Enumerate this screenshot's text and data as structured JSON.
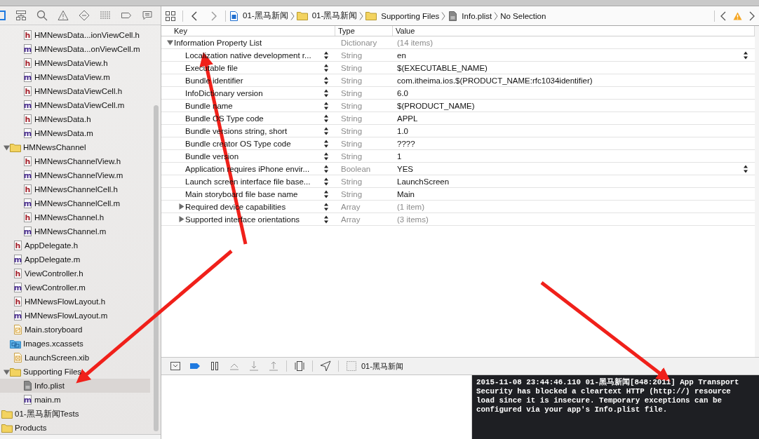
{
  "navigator": {
    "tree": [
      {
        "children": [
          {
            "children": [
              {
                "kind": "header",
                "icon_letter": "h",
                "label": "HMNewsData...ionViewCell.h",
                "selected": false
              },
              {
                "kind": "source",
                "icon_letter": "m",
                "label": "HMNewsData...onViewCell.m",
                "selected": false
              },
              {
                "kind": "header",
                "icon_letter": "h",
                "label": "HMNewsDataView.h",
                "selected": false
              },
              {
                "kind": "source",
                "icon_letter": "m",
                "label": "HMNewsDataView.m",
                "selected": false
              },
              {
                "kind": "header",
                "icon_letter": "h",
                "label": "HMNewsDataViewCell.h",
                "selected": false
              },
              {
                "kind": "source",
                "icon_letter": "m",
                "label": "HMNewsDataViewCell.m",
                "selected": false
              },
              {
                "kind": "header",
                "icon_letter": "h",
                "label": "HMNewsData.h",
                "selected": false
              },
              {
                "kind": "source",
                "icon_letter": "m",
                "label": "HMNewsData.m",
                "selected": false
              }
            ]
          },
          {
            "kind": "folder",
            "label": "HMNewsChannel",
            "expanded": true,
            "selected": false,
            "children": [
              {
                "kind": "header",
                "icon_letter": "h",
                "label": "HMNewsChannelView.h",
                "selected": false
              },
              {
                "kind": "source",
                "icon_letter": "m",
                "label": "HMNewsChannelView.m",
                "selected": false
              },
              {
                "kind": "header",
                "icon_letter": "h",
                "label": "HMNewsChannelCell.h",
                "selected": false
              },
              {
                "kind": "source",
                "icon_letter": "m",
                "label": "HMNewsChannelCell.m",
                "selected": false
              },
              {
                "kind": "header",
                "icon_letter": "h",
                "label": "HMNewsChannel.h",
                "selected": false
              },
              {
                "kind": "source",
                "icon_letter": "m",
                "label": "HMNewsChannel.m",
                "selected": false
              }
            ]
          },
          {
            "kind": "header",
            "icon_letter": "h",
            "label": "AppDelegate.h",
            "selected": false
          },
          {
            "kind": "source",
            "icon_letter": "m",
            "label": "AppDelegate.m",
            "selected": false
          },
          {
            "kind": "header",
            "icon_letter": "h",
            "label": "ViewController.h",
            "selected": false
          },
          {
            "kind": "source",
            "icon_letter": "m",
            "label": "ViewController.m",
            "selected": false
          },
          {
            "kind": "header",
            "icon_letter": "h",
            "label": "HMNewsFlowLayout.h",
            "selected": false
          },
          {
            "kind": "source",
            "icon_letter": "m",
            "label": "HMNewsFlowLayout.m",
            "selected": false
          },
          {
            "kind": "storyboard",
            "label": "Main.storyboard",
            "selected": false
          },
          {
            "kind": "assets",
            "label": "Images.xcassets",
            "selected": false
          },
          {
            "kind": "xib",
            "label": "LaunchScreen.xib",
            "selected": false
          },
          {
            "kind": "folder",
            "label": "Supporting Files",
            "expanded": true,
            "selected": false,
            "children": [
              {
                "kind": "plist",
                "label": "Info.plist",
                "selected": true
              },
              {
                "kind": "source",
                "icon_letter": "m",
                "label": "main.m",
                "selected": false
              }
            ]
          }
        ]
      },
      {
        "kind": "folder",
        "label": "01-黑马新闻Tests",
        "selected": false
      },
      {
        "kind": "folder",
        "label": "Products",
        "selected": false
      }
    ]
  },
  "jump_bar": {
    "path": [
      {
        "kind": "project",
        "label": "01-黑马新闻"
      },
      {
        "kind": "folder",
        "label": "01-黑马新闻"
      },
      {
        "kind": "folder",
        "label": "Supporting Files"
      },
      {
        "kind": "plist",
        "label": "Info.plist"
      },
      {
        "kind": "none",
        "label": "No Selection"
      }
    ]
  },
  "plist": {
    "columns": [
      "Key",
      "Type",
      "Value"
    ],
    "rows": [
      {
        "key": "Information Property List",
        "type": "Dictionary",
        "value": "(14 items)",
        "expanded": true,
        "children": [
          {
            "key": "Localization native development r...",
            "type": "String",
            "value": "en",
            "value_popup": true
          },
          {
            "key": "Executable file",
            "type": "String",
            "value": "$(EXECUTABLE_NAME)"
          },
          {
            "key": "Bundle identifier",
            "type": "String",
            "value": "com.itheima.ios.$(PRODUCT_NAME:rfc1034identifier)"
          },
          {
            "key": "InfoDictionary version",
            "type": "String",
            "value": "6.0"
          },
          {
            "key": "Bundle name",
            "type": "String",
            "value": "$(PRODUCT_NAME)"
          },
          {
            "key": "Bundle OS Type code",
            "type": "String",
            "value": "APPL"
          },
          {
            "key": "Bundle versions string, short",
            "type": "String",
            "value": "1.0"
          },
          {
            "key": "Bundle creator OS Type code",
            "type": "String",
            "value": "????"
          },
          {
            "key": "Bundle version",
            "type": "String",
            "value": "1"
          },
          {
            "key": "Application requires iPhone envir...",
            "type": "Boolean",
            "value": "YES",
            "value_popup": true
          },
          {
            "key": "Launch screen interface file base...",
            "type": "String",
            "value": "LaunchScreen"
          },
          {
            "key": "Main storyboard file base name",
            "type": "String",
            "value": "Main"
          },
          {
            "key": "Required device capabilities",
            "type": "Array",
            "value": "(1 item)",
            "expanded": false
          },
          {
            "key": "Supported interface orientations",
            "type": "Array",
            "value": "(3 items)",
            "expanded": false
          }
        ]
      }
    ]
  },
  "debug_bar": {
    "target": "01-黑马新闻"
  },
  "console": {
    "text": "2015-11-08 23:44:46.110 01-黑马新闻[848:2011] App Transport Security has blocked a cleartext HTTP (http://) resource load since it is insecure. Temporary exceptions can be configured via your app's Info.plist file."
  }
}
